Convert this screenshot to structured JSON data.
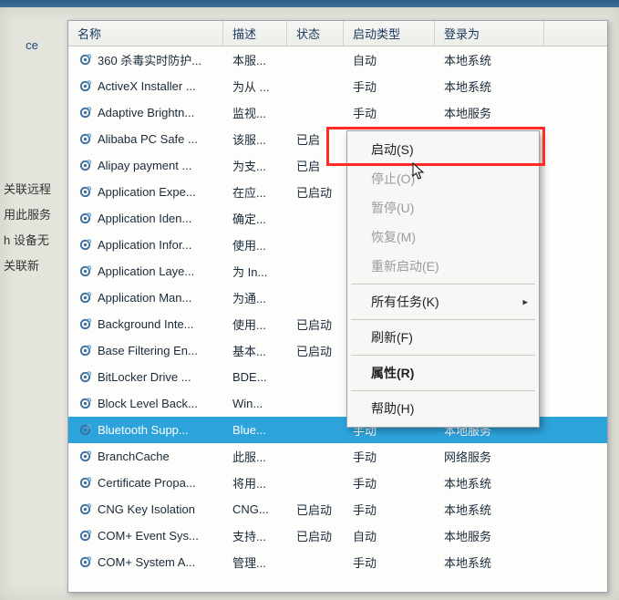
{
  "sidebar": {
    "label_top": "ce",
    "lines": [
      "关联远程",
      "用此服务",
      "h 设备无",
      "关联新"
    ]
  },
  "columns": {
    "name": "名称",
    "desc": "描述",
    "state": "状态",
    "start": "启动类型",
    "logon": "登录为"
  },
  "rows": [
    {
      "name": "360 杀毒实时防护...",
      "desc": "本服...",
      "state": "",
      "start": "自动",
      "logon": "本地系统"
    },
    {
      "name": "ActiveX Installer ...",
      "desc": "为从 ...",
      "state": "",
      "start": "手动",
      "logon": "本地系统"
    },
    {
      "name": "Adaptive Brightn...",
      "desc": "监视...",
      "state": "",
      "start": "手动",
      "logon": "本地服务"
    },
    {
      "name": "Alibaba PC Safe ...",
      "desc": "该服...",
      "state": "已启",
      "start": "",
      "logon": ""
    },
    {
      "name": "Alipay payment ...",
      "desc": "为支...",
      "state": "已启",
      "start": "",
      "logon": ""
    },
    {
      "name": "Application Expe...",
      "desc": "在应...",
      "state": "已启动",
      "start": "",
      "logon": ""
    },
    {
      "name": "Application Iden...",
      "desc": "确定...",
      "state": "",
      "start": "",
      "logon": ""
    },
    {
      "name": "Application Infor...",
      "desc": "使用...",
      "state": "",
      "start": "",
      "logon": ""
    },
    {
      "name": "Application Laye...",
      "desc": "为 In...",
      "state": "",
      "start": "",
      "logon": ""
    },
    {
      "name": "Application Man...",
      "desc": "为通...",
      "state": "",
      "start": "",
      "logon": ""
    },
    {
      "name": "Background Inte...",
      "desc": "使用...",
      "state": "已启动",
      "start": "",
      "logon": ""
    },
    {
      "name": "Base Filtering En...",
      "desc": "基本...",
      "state": "已启动",
      "start": "",
      "logon": ""
    },
    {
      "name": "BitLocker Drive ...",
      "desc": "BDE...",
      "state": "",
      "start": "",
      "logon": ""
    },
    {
      "name": "Block Level Back...",
      "desc": "Win...",
      "state": "",
      "start": "",
      "logon": ""
    },
    {
      "name": "Bluetooth Supp...",
      "desc": "Blue...",
      "state": "",
      "start": "手动",
      "logon": "本地服务",
      "selected": true
    },
    {
      "name": "BranchCache",
      "desc": "此服...",
      "state": "",
      "start": "手动",
      "logon": "网络服务"
    },
    {
      "name": "Certificate Propa...",
      "desc": "将用...",
      "state": "",
      "start": "手动",
      "logon": "本地系统"
    },
    {
      "name": "CNG Key Isolation",
      "desc": "CNG...",
      "state": "已启动",
      "start": "手动",
      "logon": "本地系统"
    },
    {
      "name": "COM+ Event Sys...",
      "desc": "支持...",
      "state": "已启动",
      "start": "自动",
      "logon": "本地服务"
    },
    {
      "name": "COM+ System A...",
      "desc": "管理...",
      "state": "",
      "start": "手动",
      "logon": "本地系统"
    }
  ],
  "context_menu": {
    "items": [
      {
        "label": "启动(S)",
        "disabled": false
      },
      {
        "label": "停止(O)",
        "disabled": true
      },
      {
        "label": "暂停(U)",
        "disabled": true
      },
      {
        "label": "恢复(M)",
        "disabled": true
      },
      {
        "label": "重新启动(E)",
        "disabled": true
      },
      {
        "sep": true
      },
      {
        "label": "所有任务(K)",
        "disabled": false,
        "submenu": true
      },
      {
        "sep": true
      },
      {
        "label": "刷新(F)",
        "disabled": false
      },
      {
        "sep": true
      },
      {
        "label": "属性(R)",
        "disabled": false,
        "bold": true
      },
      {
        "sep": true
      },
      {
        "label": "帮助(H)",
        "disabled": false
      }
    ]
  },
  "colors": {
    "highlight": "#ff2b24",
    "selection": "#2da3dc"
  }
}
